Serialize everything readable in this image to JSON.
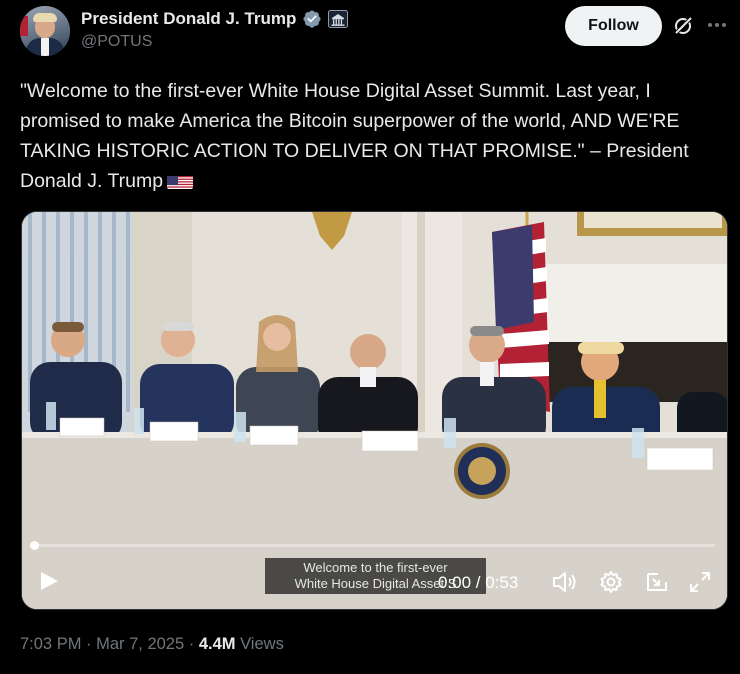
{
  "author": {
    "display_name": "President Donald J. Trump",
    "handle": "@POTUS",
    "verified_badge_color": "#829aab"
  },
  "actions": {
    "follow_label": "Follow"
  },
  "tweet": {
    "text": "\"Welcome to the first-ever White House Digital Asset Summit. Last year, I promised to make America the Bitcoin superpower of the world, AND WE'RE TAKING HISTORIC ACTION TO DELIVER ON THAT PROMISE.\" – President Donald J. Trump",
    "emoji": "us-flag"
  },
  "video": {
    "caption_line1": "Welcome to the first-ever",
    "caption_line2": "White House Digital Asset S",
    "time_display": "0:00 / 0:53",
    "progress_fraction": 0.0,
    "accent_color": "#1d9bf0"
  },
  "meta": {
    "timestamp": "7:03 PM · Mar 7, 2025 · ",
    "views_count": "4.4M",
    "views_label": " Views"
  }
}
